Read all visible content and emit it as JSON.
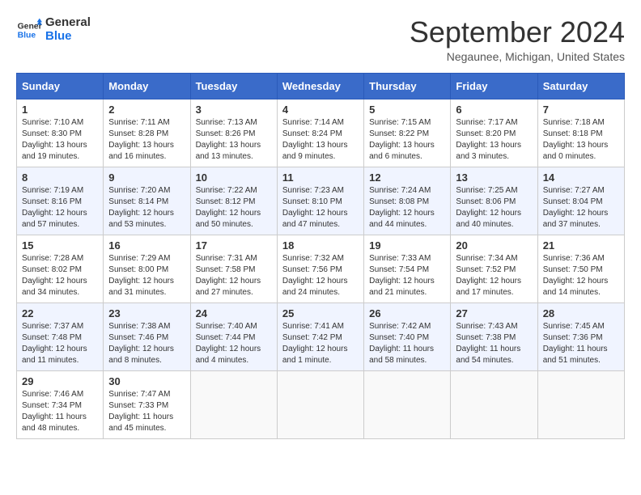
{
  "header": {
    "logo_line1": "General",
    "logo_line2": "Blue",
    "month": "September 2024",
    "location": "Negaunee, Michigan, United States"
  },
  "weekdays": [
    "Sunday",
    "Monday",
    "Tuesday",
    "Wednesday",
    "Thursday",
    "Friday",
    "Saturday"
  ],
  "weeks": [
    [
      {
        "day": "1",
        "sunrise": "7:10 AM",
        "sunset": "8:30 PM",
        "daylight": "13 hours and 19 minutes."
      },
      {
        "day": "2",
        "sunrise": "7:11 AM",
        "sunset": "8:28 PM",
        "daylight": "13 hours and 16 minutes."
      },
      {
        "day": "3",
        "sunrise": "7:13 AM",
        "sunset": "8:26 PM",
        "daylight": "13 hours and 13 minutes."
      },
      {
        "day": "4",
        "sunrise": "7:14 AM",
        "sunset": "8:24 PM",
        "daylight": "13 hours and 9 minutes."
      },
      {
        "day": "5",
        "sunrise": "7:15 AM",
        "sunset": "8:22 PM",
        "daylight": "13 hours and 6 minutes."
      },
      {
        "day": "6",
        "sunrise": "7:17 AM",
        "sunset": "8:20 PM",
        "daylight": "13 hours and 3 minutes."
      },
      {
        "day": "7",
        "sunrise": "7:18 AM",
        "sunset": "8:18 PM",
        "daylight": "13 hours and 0 minutes."
      }
    ],
    [
      {
        "day": "8",
        "sunrise": "7:19 AM",
        "sunset": "8:16 PM",
        "daylight": "12 hours and 57 minutes."
      },
      {
        "day": "9",
        "sunrise": "7:20 AM",
        "sunset": "8:14 PM",
        "daylight": "12 hours and 53 minutes."
      },
      {
        "day": "10",
        "sunrise": "7:22 AM",
        "sunset": "8:12 PM",
        "daylight": "12 hours and 50 minutes."
      },
      {
        "day": "11",
        "sunrise": "7:23 AM",
        "sunset": "8:10 PM",
        "daylight": "12 hours and 47 minutes."
      },
      {
        "day": "12",
        "sunrise": "7:24 AM",
        "sunset": "8:08 PM",
        "daylight": "12 hours and 44 minutes."
      },
      {
        "day": "13",
        "sunrise": "7:25 AM",
        "sunset": "8:06 PM",
        "daylight": "12 hours and 40 minutes."
      },
      {
        "day": "14",
        "sunrise": "7:27 AM",
        "sunset": "8:04 PM",
        "daylight": "12 hours and 37 minutes."
      }
    ],
    [
      {
        "day": "15",
        "sunrise": "7:28 AM",
        "sunset": "8:02 PM",
        "daylight": "12 hours and 34 minutes."
      },
      {
        "day": "16",
        "sunrise": "7:29 AM",
        "sunset": "8:00 PM",
        "daylight": "12 hours and 31 minutes."
      },
      {
        "day": "17",
        "sunrise": "7:31 AM",
        "sunset": "7:58 PM",
        "daylight": "12 hours and 27 minutes."
      },
      {
        "day": "18",
        "sunrise": "7:32 AM",
        "sunset": "7:56 PM",
        "daylight": "12 hours and 24 minutes."
      },
      {
        "day": "19",
        "sunrise": "7:33 AM",
        "sunset": "7:54 PM",
        "daylight": "12 hours and 21 minutes."
      },
      {
        "day": "20",
        "sunrise": "7:34 AM",
        "sunset": "7:52 PM",
        "daylight": "12 hours and 17 minutes."
      },
      {
        "day": "21",
        "sunrise": "7:36 AM",
        "sunset": "7:50 PM",
        "daylight": "12 hours and 14 minutes."
      }
    ],
    [
      {
        "day": "22",
        "sunrise": "7:37 AM",
        "sunset": "7:48 PM",
        "daylight": "12 hours and 11 minutes."
      },
      {
        "day": "23",
        "sunrise": "7:38 AM",
        "sunset": "7:46 PM",
        "daylight": "12 hours and 8 minutes."
      },
      {
        "day": "24",
        "sunrise": "7:40 AM",
        "sunset": "7:44 PM",
        "daylight": "12 hours and 4 minutes."
      },
      {
        "day": "25",
        "sunrise": "7:41 AM",
        "sunset": "7:42 PM",
        "daylight": "12 hours and 1 minute."
      },
      {
        "day": "26",
        "sunrise": "7:42 AM",
        "sunset": "7:40 PM",
        "daylight": "11 hours and 58 minutes."
      },
      {
        "day": "27",
        "sunrise": "7:43 AM",
        "sunset": "7:38 PM",
        "daylight": "11 hours and 54 minutes."
      },
      {
        "day": "28",
        "sunrise": "7:45 AM",
        "sunset": "7:36 PM",
        "daylight": "11 hours and 51 minutes."
      }
    ],
    [
      {
        "day": "29",
        "sunrise": "7:46 AM",
        "sunset": "7:34 PM",
        "daylight": "11 hours and 48 minutes."
      },
      {
        "day": "30",
        "sunrise": "7:47 AM",
        "sunset": "7:33 PM",
        "daylight": "11 hours and 45 minutes."
      },
      null,
      null,
      null,
      null,
      null
    ]
  ],
  "labels": {
    "sunrise": "Sunrise: ",
    "sunset": "Sunset: ",
    "daylight": "Daylight: "
  }
}
